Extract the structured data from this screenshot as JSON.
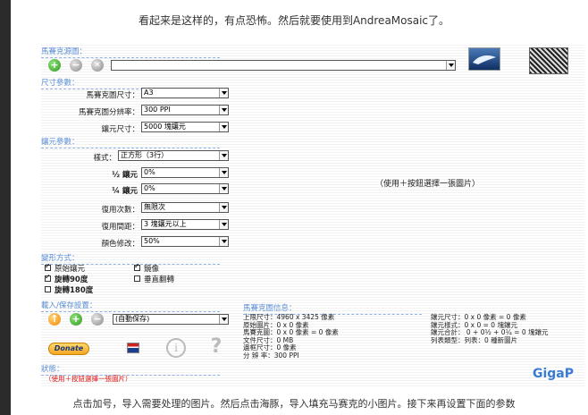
{
  "captions": {
    "top": "看起来是这样的，有点恐怖。然后就要使用到AndreaMosaic了。",
    "bottom": "点击加号，导入需要处理的图片。然后点击海豚，导入填充马赛克的小图片。接下来再设置下面的参数"
  },
  "sections": {
    "source": "馬賽克源圖：",
    "size": "尺寸參數：",
    "tile": "鑲元參數：",
    "transform": "變形方式：",
    "loadsave": "載入/保存設置：",
    "status": "狀態：",
    "info": "馬賽克圖信息："
  },
  "size_params": {
    "mosaic_size": {
      "label": "馬賽克圖尺寸：",
      "value": "A3"
    },
    "resolution": {
      "label": "馬賽克圖分辨率：",
      "value": "300 PPI"
    },
    "tile_size": {
      "label": "鑲元尺寸：",
      "value": "5000 塊鑲元"
    }
  },
  "tile_params": {
    "style": {
      "label": "樣式：",
      "value": "正方形（3行）"
    },
    "half": {
      "label": "½ 鑲元",
      "value": "0%"
    },
    "quarter": {
      "label": "¼ 鑲元",
      "value": "0%"
    },
    "reuse_count": {
      "label": "復用次數：",
      "value": "無限次"
    },
    "reuse_distance": {
      "label": "復用間距：",
      "value": "3 塊鑲元以上"
    },
    "color_change": {
      "label": "顏色修改：",
      "value": "50%"
    }
  },
  "preview_message": "（使用＋按鈕選擇一張圖片）",
  "transform": {
    "original": "原始鑲元",
    "mirror": "鏡像",
    "rotate90": "旋轉90度",
    "vflip": "垂直翻轉",
    "rotate180": "旋轉180度",
    "states": {
      "original": true,
      "mirror": true,
      "rotate90": true,
      "vflip": false,
      "rotate180": false
    }
  },
  "loadsave": {
    "value": "(自動保存)"
  },
  "donate_label": "Donate",
  "status_text": "（使用＋按鈕選擇一張圖片）",
  "info_left": [
    "上限尺寸：4960 x 3425 像素",
    "原始圖片：0 x 0 像素",
    "馬賽克圖：0 x 0 像素 = 0 像素",
    "文件尺寸：0 MB",
    "邊框尺寸：0 像素",
    "分 辨 率：300 PPI"
  ],
  "info_right": [
    "鑲元尺寸：0 x 0 像素 = 0 像素",
    "鑲元樣式：0 x 0 = 0 塊鑲元",
    "鑲元合計： 0 + 0½ + 0¼ = 0 塊鑲元",
    "列表類型：列表：0 種新圖片"
  ],
  "logo": "GigaP",
  "icons": {
    "add": "plus-icon",
    "remove": "minus-icon",
    "clear": "x-icon",
    "load": "up-arrow-icon",
    "help": "question-icon",
    "info": "info-icon",
    "lang": "flag-icon",
    "dolphin": "dolphin-icon",
    "preview": "preview-icon"
  }
}
